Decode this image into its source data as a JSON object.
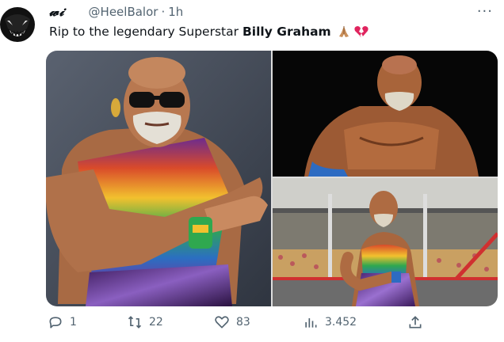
{
  "author": {
    "name": "𝔀𝓲",
    "handle": "@HeelBalor",
    "separator": "·",
    "time": "1h"
  },
  "more_label": "···",
  "tweet": {
    "text_before": "Rip to the legendary Superstar",
    "text_bold": "Billy Graham"
  },
  "emojis": [
    "pray-emoji",
    "broken-heart-emoji"
  ],
  "actions": {
    "replies": "1",
    "retweets": "22",
    "likes": "83",
    "views": "3.452"
  },
  "colors": {
    "text": "#0f1419",
    "secondary": "#536471",
    "broken_heart": "#e0245e"
  }
}
